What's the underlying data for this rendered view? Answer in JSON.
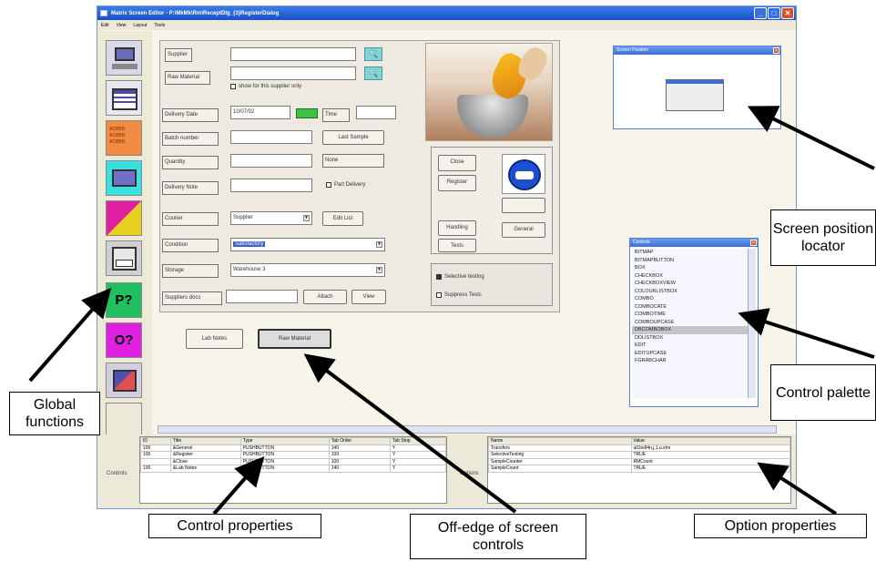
{
  "window": {
    "title": "Matrix Screen Editor - P:\\MkMk\\Rm\\ReceptDlg_{3}RegisterDialog",
    "controls": {
      "minimize": "_",
      "maximize": "□",
      "close": "✕"
    }
  },
  "menu": [
    "Edit",
    "View",
    "Layout",
    "Tools"
  ],
  "toolbar": {
    "tools": [
      {
        "name": "screen-tool-icon",
        "color": "#6a6ab8"
      },
      {
        "name": "window-tool-icon",
        "color": "#4a4aa8"
      },
      {
        "name": "text-list-tool-icon",
        "color": "#f08a40",
        "text": "ACBBB\nACBBB\nACBBB"
      },
      {
        "name": "frame-tool-icon",
        "color": "#3ae0e0"
      },
      {
        "name": "label-tool-icon",
        "color": "#e8d020"
      },
      {
        "name": "save-tool-icon",
        "color": "#d0d0d0"
      },
      {
        "name": "p-query-tool-icon",
        "color": "#20c060",
        "text": "P?"
      },
      {
        "name": "o-query-tool-icon",
        "color": "#e020e0",
        "text": "O?"
      },
      {
        "name": "picture-tool-icon",
        "color": "#7070c0"
      }
    ]
  },
  "form": {
    "supplier_label": "Supplier",
    "raw_material_label": "Raw Material",
    "show_supplier_only": "show for this supplier only",
    "delivery_date_label": "Delivery Date",
    "delivery_date_value": "10/07/02",
    "time_label": "Time",
    "batch_number_label": "Batch number",
    "last_sample_button": "Last Sample",
    "quantity_label": "Quantity",
    "none_value": "None",
    "delivery_note_label": "Delivery Note",
    "part_delivery": "Part Delivery",
    "courier_label": "Courier",
    "courier_value": "Supplier",
    "edit_list_button": "Edit List",
    "condition_label": "Condition",
    "condition_value": "Satisfactory",
    "storage_label": "Storage",
    "storage_value": "Warehouse 3",
    "suppliers_docs_label": "Suppliers docs",
    "attach_button": "Attach",
    "view_button": "View",
    "close_button": "Close",
    "register_button": "Register",
    "handling_button": "Handling",
    "tests_button": "Tests",
    "general_button": "General",
    "selective_testing": "Selective testing",
    "suppress_tests": "Suppress Tests",
    "lab_notes_button": "Lab Notes",
    "raw_material_button": "Raw Material"
  },
  "screen_position": {
    "title": "Screen Position"
  },
  "palette": {
    "title": "Controls",
    "items": [
      "BITMAP",
      "BITMAPBUTTON",
      "BOX",
      "CHECKBOX",
      "CHECKBOXVIEW",
      "COLOURLISTBOX",
      "COMBO",
      "COMBOCATE",
      "COMBOTIME",
      "COMBOUPCASE",
      "DBCOMBOBOX",
      "DDLISTBOX",
      "EDIT",
      "EDITUPCASE",
      "FGRABCHAR"
    ],
    "selected": "DBCOMBOBOX"
  },
  "controls_grid": {
    "side_label": "Controls",
    "headers": [
      "ID",
      "Title",
      "Type",
      "Tab Order",
      "Tab Stop"
    ],
    "rows": [
      [
        "100",
        "&General",
        "PUSHBUTTON",
        "140",
        "Y"
      ],
      [
        "100",
        "&Register",
        "PUSHBUTTON",
        "100",
        "Y"
      ],
      [
        "",
        "&Close",
        "PUSHBUTTON",
        "100",
        "Y"
      ],
      [
        "100",
        "&Lab Notes",
        "PUSHBUTTON",
        "140",
        "Y"
      ]
    ]
  },
  "options_grid": {
    "side_label": "Options",
    "headers": [
      "Name",
      "Value"
    ],
    "rows": [
      [
        "Transfers",
        "ul1bv84n,j,1,u.vtre"
      ],
      [
        "SelectiveTesting",
        "TRUE"
      ],
      [
        "SampleCounter",
        "RMCount"
      ],
      [
        "SampleCount",
        "TRUE"
      ]
    ]
  },
  "callouts": {
    "screen_position_locator": "Screen position locator",
    "control_palette": "Control palette",
    "global_functions": "Global functions",
    "control_properties": "Control  properties",
    "off_edge": "Off-edge of screen controls",
    "option_properties": "Option properties"
  }
}
